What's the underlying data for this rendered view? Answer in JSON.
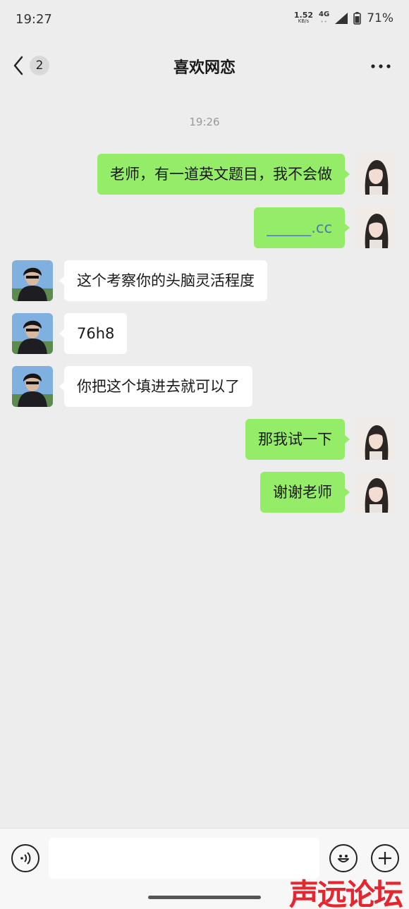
{
  "status_bar": {
    "time": "19:27",
    "net_speed": "1.52",
    "net_speed_unit": "KB/s",
    "network": "4G",
    "battery": "71%"
  },
  "header": {
    "unread_count": "2",
    "title": "喜欢网恋"
  },
  "chat": {
    "timestamp": "19:26",
    "messages": [
      {
        "side": "right",
        "text": "老师，有一道英文题目，我不会做"
      },
      {
        "side": "right",
        "text": "______.cc"
      },
      {
        "side": "left",
        "text": "这个考察你的头脑灵活程度"
      },
      {
        "side": "left",
        "text": "76h8"
      },
      {
        "side": "left",
        "text": "你把这个填进去就可以了"
      },
      {
        "side": "right",
        "text": "那我试一下"
      },
      {
        "side": "right",
        "text": "谢谢老师"
      }
    ]
  },
  "input_bar": {
    "voice_icon": "voice-icon",
    "emoji_icon": "emoji-icon",
    "plus_icon": "plus-icon",
    "placeholder": ""
  },
  "watermark": "声远论坛",
  "colors": {
    "background": "#ededed",
    "self_bubble": "#95ec69",
    "other_bubble": "#ffffff",
    "watermark": "#e5262f"
  }
}
